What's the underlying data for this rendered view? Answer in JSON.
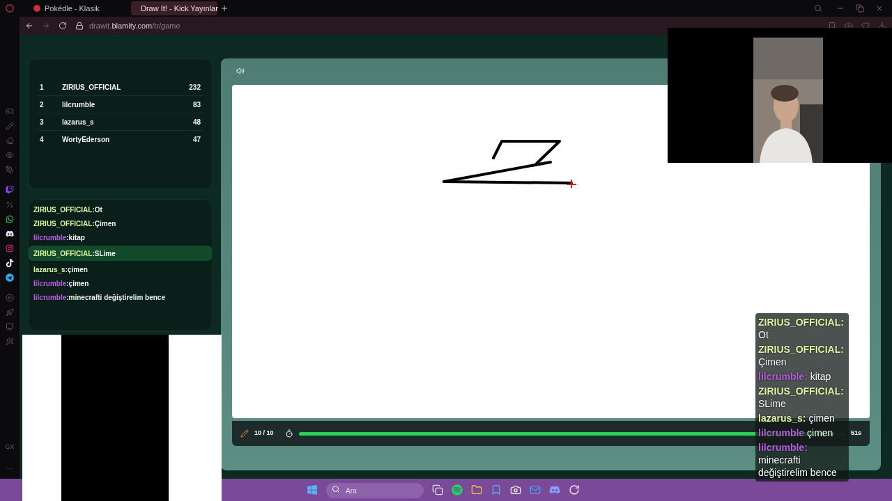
{
  "browser": {
    "tabs": [
      {
        "label": "Pokédle - Klasik",
        "selected": false
      },
      {
        "label": "Draw It! - Kick Yayınlar",
        "selected": true
      }
    ],
    "url": {
      "host_prefix": "drawit.",
      "host": "blamity.com",
      "path": "/tr/game"
    }
  },
  "sidebar": {
    "bottom": [
      "GX",
      "···"
    ]
  },
  "leaderboard": [
    {
      "rank": "1",
      "name": "ZIRIUS_OFFICIAL",
      "score": "232"
    },
    {
      "rank": "2",
      "name": "lilcrumble",
      "score": "83"
    },
    {
      "rank": "3",
      "name": "lazarus_s",
      "score": "48"
    },
    {
      "rank": "4",
      "name": "WortyEderson",
      "score": "47"
    }
  ],
  "chat": [
    {
      "user": "ZIRIUS_OFFICIAL",
      "color": "#d9f5a0",
      "text": ":Ot",
      "highlighted": false
    },
    {
      "user": "ZIRIUS_OFFICIAL",
      "color": "#d9f5a0",
      "text": ":Çimen",
      "highlighted": false
    },
    {
      "user": "lilcrumble",
      "color": "#c05ce8",
      "text": ":kitap",
      "highlighted": false
    },
    {
      "user": "ZIRIUS_OFFICIAL",
      "color": "#d9f5a0",
      "text": ":SLime",
      "highlighted": true
    },
    {
      "user": "lazarus_s",
      "color": "#d9f5a0",
      "text": ":çimen",
      "highlighted": false
    },
    {
      "user": "lilcrumble",
      "color": "#c05ce8",
      "text": ":çimen",
      "highlighted": false
    },
    {
      "user": "lilcrumble",
      "color": "#c05ce8",
      "text": ":minecrafti değiştirelim bence",
      "highlighted": false
    }
  ],
  "game": {
    "round": "10 / 10",
    "timer": {
      "level": 0.98,
      "reading": "51s"
    }
  },
  "stream_chat": [
    {
      "user": "ZIRIUS_OFFICIAL:",
      "color": "#e2f7a8",
      "text": "Ot"
    },
    {
      "user": "ZIRIUS_OFFICIAL:",
      "color": "#e2f7a8",
      "text": "Çimen"
    },
    {
      "user": "lilcrumble:",
      "color": "#b65ee0",
      "text": "kitap"
    },
    {
      "user": "ZIRIUS_OFFICIAL:",
      "color": "#e2f7a8",
      "text": "SLime"
    },
    {
      "user": "lazarus_s:",
      "color": "#e2f7a8",
      "text": "çimen"
    },
    {
      "user": "lilcrumble",
      "color": "#b65ee0",
      "text": "çimen"
    },
    {
      "user": "lilcrumble:",
      "color": "#b65ee0",
      "text": "minecrafti değiştirelim bence"
    }
  ],
  "taskbar": {
    "search": {
      "placeholder": "Ara"
    }
  }
}
